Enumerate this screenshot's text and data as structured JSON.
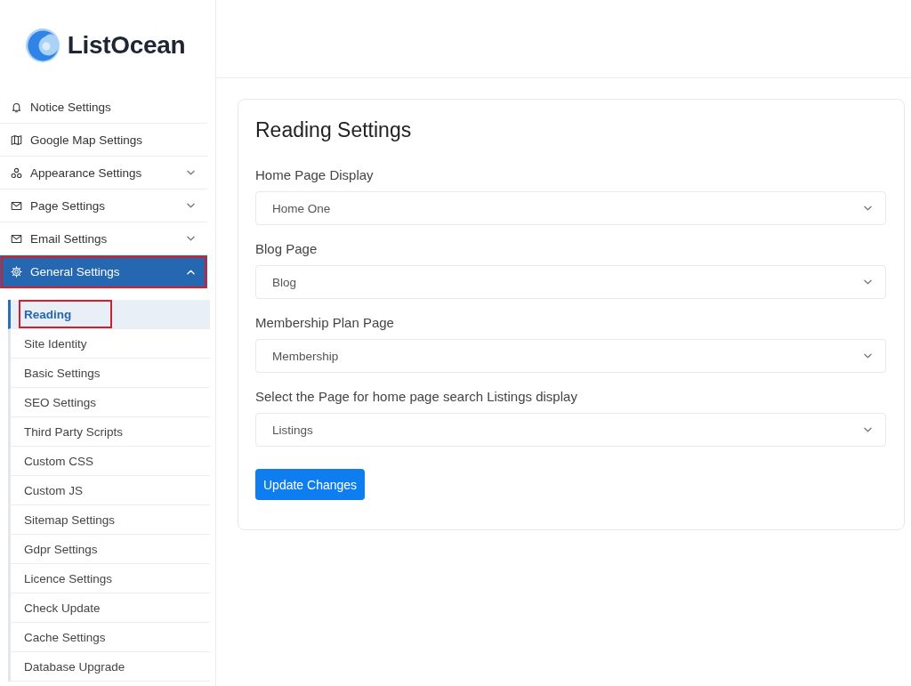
{
  "sidebar": {
    "logo": {
      "text": "ListOcean"
    },
    "items": [
      {
        "label": "Notice Settings",
        "selected": false,
        "highlighted": false
      },
      {
        "label": "Google Map Settings",
        "selected": false,
        "highlighted": false
      },
      {
        "label": "Appearance Settings",
        "selected": false,
        "highlighted": false,
        "expanded": false
      },
      {
        "label": "Page Settings",
        "selected": false,
        "highlighted": false,
        "expanded": false
      },
      {
        "label": "Email Settings",
        "selected": false,
        "highlighted": false,
        "expanded": false
      },
      {
        "label": "General Settings",
        "selected": true,
        "highlighted": true,
        "expanded": true,
        "children": [
          {
            "label": "Reading",
            "selected": true,
            "highlighted": true
          },
          {
            "label": "Site Identity",
            "selected": false,
            "highlighted": false
          },
          {
            "label": "Basic Settings",
            "selected": false,
            "highlighted": false
          },
          {
            "label": "SEO Settings",
            "selected": false,
            "highlighted": false
          },
          {
            "label": "Third Party Scripts",
            "selected": false,
            "highlighted": false
          },
          {
            "label": "Custom CSS",
            "selected": false,
            "highlighted": false
          },
          {
            "label": "Custom JS",
            "selected": false,
            "highlighted": false
          },
          {
            "label": "Sitemap Settings",
            "selected": false,
            "highlighted": false
          },
          {
            "label": "Gdpr Settings",
            "selected": false,
            "highlighted": false
          },
          {
            "label": "Licence Settings",
            "selected": false,
            "highlighted": false
          },
          {
            "label": "Check Update",
            "selected": false,
            "highlighted": false
          },
          {
            "label": "Cache Settings",
            "selected": false,
            "highlighted": false
          },
          {
            "label": "Database Upgrade",
            "selected": false,
            "highlighted": false
          }
        ]
      }
    ]
  },
  "form": {
    "title": "Reading Settings",
    "fields": [
      {
        "label": "Home Page Display",
        "value": "Home One"
      },
      {
        "label": "Blog Page",
        "value": "Blog"
      },
      {
        "label": "Membership Plan Page",
        "value": "Membership"
      },
      {
        "label": "Select the Page for home page search Listings display",
        "value": "Listings"
      }
    ],
    "submit_button": "Update Changes"
  }
}
